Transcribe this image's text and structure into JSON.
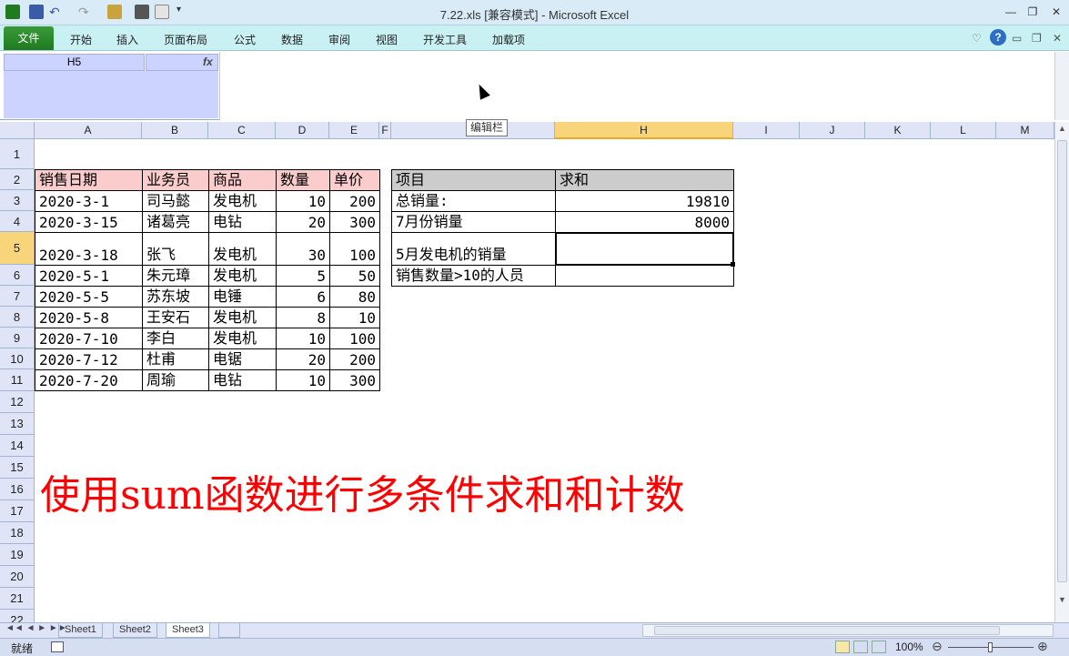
{
  "window": {
    "title": "7.22.xls  [兼容模式]  -  Microsoft Excel"
  },
  "ribbon": {
    "tabs": [
      "文件",
      "开始",
      "插入",
      "页面布局",
      "公式",
      "数据",
      "审阅",
      "视图",
      "开发工具",
      "加载项"
    ]
  },
  "formula_bar": {
    "name_box": "H5",
    "fx_label": "fx",
    "formula": "",
    "tooltip": "编辑栏"
  },
  "columns": [
    "A",
    "B",
    "C",
    "D",
    "E",
    "F",
    "H",
    "I",
    "J",
    "K",
    "L",
    "M"
  ],
  "rows": [
    "1",
    "2",
    "3",
    "4",
    "5",
    "6",
    "7",
    "8",
    "9",
    "10",
    "11",
    "12",
    "13",
    "14",
    "15",
    "16",
    "17",
    "18",
    "19",
    "20",
    "21",
    "22"
  ],
  "table1": {
    "headers": [
      "销售日期",
      "业务员",
      "商品",
      "数量",
      "单价"
    ],
    "rows": [
      [
        "2020-3-1",
        "司马懿",
        "发电机",
        "10",
        "200"
      ],
      [
        "2020-3-15",
        "诸葛亮",
        "电钻",
        "20",
        "300"
      ],
      [
        "2020-3-18",
        "张飞",
        "发电机",
        "30",
        "100"
      ],
      [
        "2020-5-1",
        "朱元璋",
        "发电机",
        "5",
        "50"
      ],
      [
        "2020-5-5",
        "苏东坡",
        "电锤",
        "6",
        "80"
      ],
      [
        "2020-5-8",
        "王安石",
        "发电机",
        "8",
        "10"
      ],
      [
        "2020-7-10",
        "李白",
        "发电机",
        "10",
        "100"
      ],
      [
        "2020-7-12",
        "杜甫",
        "电锯",
        "20",
        "200"
      ],
      [
        "2020-7-20",
        "周瑜",
        "电钻",
        "10",
        "300"
      ]
    ]
  },
  "table2": {
    "headers": [
      "项目",
      "求和"
    ],
    "rows": [
      [
        "总销量:",
        "19810"
      ],
      [
        "7月份销量",
        "8000"
      ],
      [
        "5月发电机的销量",
        ""
      ],
      [
        "销售数量>10的人员",
        ""
      ]
    ]
  },
  "annotation": "使用sum函数进行多条件求和和计数",
  "sheets": [
    "Sheet1",
    "Sheet2",
    "Sheet3"
  ],
  "active_sheet": "Sheet3",
  "status": {
    "ready": "就绪",
    "zoom": "100%"
  }
}
